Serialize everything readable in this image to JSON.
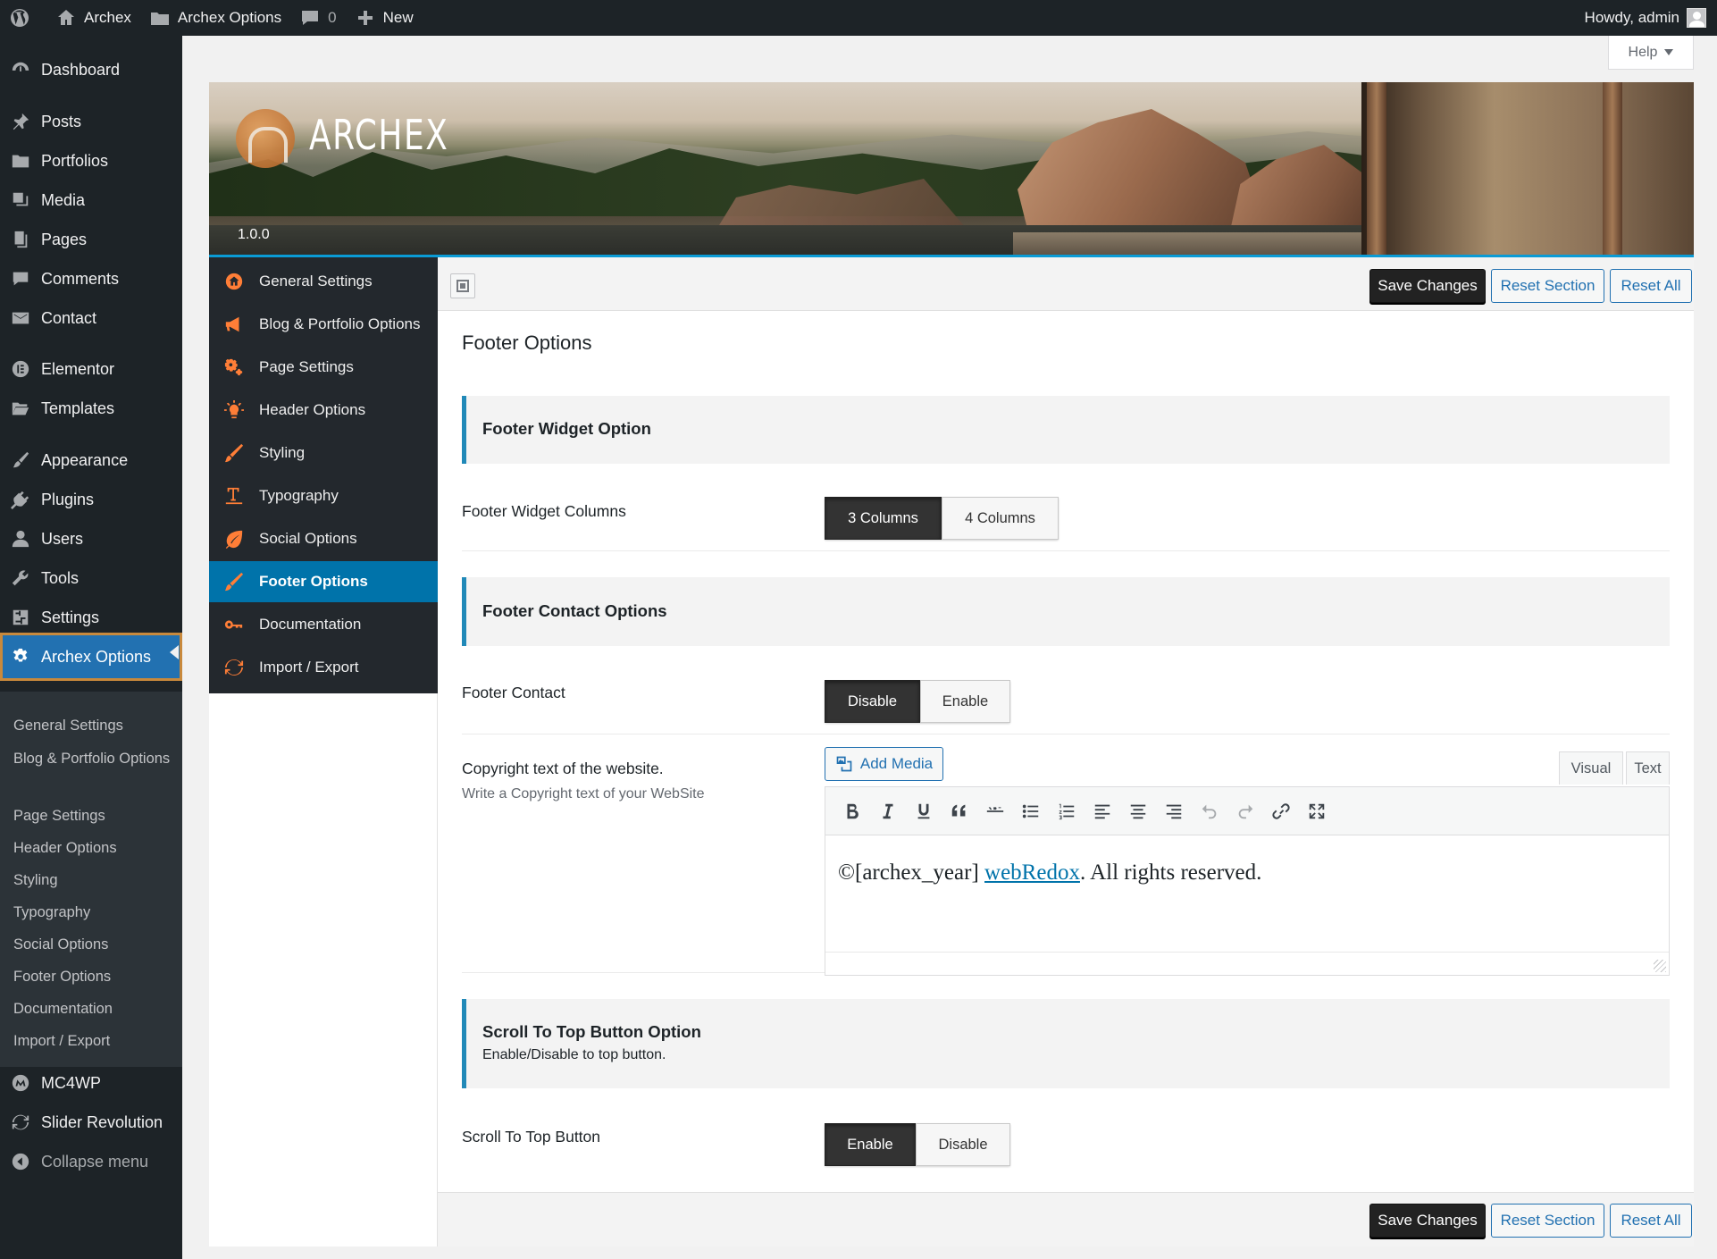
{
  "adminbar": {
    "site_name": "Archex",
    "options_name": "Archex Options",
    "comments_count": "0",
    "new_label": "New",
    "howdy": "Howdy, admin"
  },
  "menu": {
    "dashboard": "Dashboard",
    "posts": "Posts",
    "portfolios": "Portfolios",
    "media": "Media",
    "pages": "Pages",
    "comments": "Comments",
    "contact": "Contact",
    "elementor": "Elementor",
    "templates": "Templates",
    "appearance": "Appearance",
    "plugins": "Plugins",
    "users": "Users",
    "tools": "Tools",
    "settings": "Settings",
    "archex_options": "Archex Options",
    "mc4wp": "MC4WP",
    "slider_revolution": "Slider Revolution",
    "collapse": "Collapse menu"
  },
  "submenu": [
    "General Settings",
    "Blog & Portfolio Options",
    "Page Settings",
    "Header Options",
    "Styling",
    "Typography",
    "Social Options",
    "Footer Options",
    "Documentation",
    "Import / Export"
  ],
  "help_label": "Help",
  "banner": {
    "logo_text": "ARCHEX",
    "version": "1.0.0"
  },
  "options_nav": [
    {
      "label": "General Settings",
      "icon": "home-icon"
    },
    {
      "label": "Blog & Portfolio Options",
      "icon": "megaphone-icon"
    },
    {
      "label": "Page Settings",
      "icon": "gears-icon"
    },
    {
      "label": "Header Options",
      "icon": "lightbulb-icon"
    },
    {
      "label": "Styling",
      "icon": "brush-icon"
    },
    {
      "label": "Typography",
      "icon": "text-icon"
    },
    {
      "label": "Social Options",
      "icon": "leaf-icon"
    },
    {
      "label": "Footer Options",
      "icon": "brush-icon"
    },
    {
      "label": "Documentation",
      "icon": "key-icon"
    },
    {
      "label": "Import / Export",
      "icon": "refresh-icon"
    }
  ],
  "active_nav": "Footer Options",
  "toolbar": {
    "save": "Save Changes",
    "reset_section": "Reset Section",
    "reset_all": "Reset All"
  },
  "section_title": "Footer Options",
  "groups": {
    "widget": {
      "title": "Footer Widget Option"
    },
    "contact": {
      "title": "Footer Contact Options"
    },
    "scroll": {
      "title": "Scroll To Top Button Option",
      "desc": "Enable/Disable to top button."
    }
  },
  "fields": {
    "widget_columns": {
      "label": "Footer Widget Columns",
      "options": [
        "3 Columns",
        "4 Columns"
      ],
      "selected": "3 Columns"
    },
    "footer_contact": {
      "label": "Footer Contact",
      "options": [
        "Disable",
        "Enable"
      ],
      "selected": "Disable"
    },
    "copyright": {
      "label": "Copyright text of the website.",
      "desc": "Write a Copyright text of your WebSite",
      "add_media": "Add Media",
      "tab_visual": "Visual",
      "tab_text": "Text",
      "content_before": "©[archex_year] ",
      "content_link": "webRedox",
      "content_after": ". All rights reserved."
    },
    "scroll_top": {
      "label": "Scroll To Top Button",
      "options": [
        "Enable",
        "Disable"
      ],
      "selected": "Enable"
    }
  },
  "colors": {
    "admin_dark": "#1d2327",
    "wp_blue": "#2271b1",
    "nav_active": "#0073aa",
    "nav_icon": "#ff7e37",
    "group_accent": "#2189b8",
    "highlight_outline": "#c8893c"
  }
}
